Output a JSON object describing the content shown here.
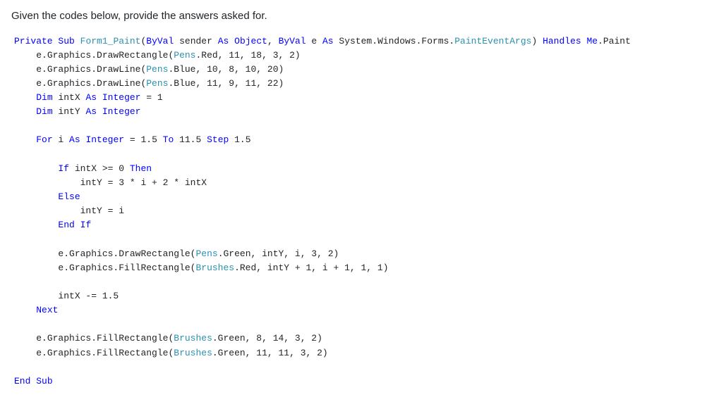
{
  "question": "Given the codes below, provide the answers asked for.",
  "code": {
    "l00a": "Private",
    "l00b": "Sub",
    "l00c": "Form1_Paint",
    "l00d": "(",
    "l00e": "ByVal",
    "l00f": " sender ",
    "l00g": "As",
    "l00h": "Object",
    "l00i": ", ",
    "l00j": "ByVal",
    "l00k": " e ",
    "l00l": "As",
    "l00m": " System.Windows.Forms.",
    "l00n": "PaintEventArgs",
    "l00o": ") ",
    "l00p": "Handles",
    "l00q": "Me",
    "l00r": ".Paint",
    "l01a": "e.Graphics.DrawRectangle(",
    "l01b": "Pens",
    "l01c": ".Red, 11, 18, 3, 2)",
    "l02a": "e.Graphics.DrawLine(",
    "l02b": "Pens",
    "l02c": ".Blue, 10, 8, 10, 20)",
    "l03a": "e.Graphics.DrawLine(",
    "l03b": "Pens",
    "l03c": ".Blue, 11, 9, 11, 22)",
    "l04a": "Dim",
    "l04b": " intX ",
    "l04c": "As",
    "l04d": "Integer",
    "l04e": " = 1",
    "l05a": "Dim",
    "l05b": " intY ",
    "l05c": "As",
    "l05d": "Integer",
    "l06a": "For",
    "l06b": " i ",
    "l06c": "As",
    "l06d": "Integer",
    "l06e": " = 1.5 ",
    "l06f": "To",
    "l06g": " 11.5 ",
    "l06h": "Step",
    "l06i": " 1.5",
    "l07a": "If",
    "l07b": " intX >= 0 ",
    "l07c": "Then",
    "l08a": "intY = 3 * i + 2 * intX",
    "l09a": "Else",
    "l10a": "intY = i",
    "l11a": "End",
    "l11b": "If",
    "l12a": "e.Graphics.DrawRectangle(",
    "l12b": "Pens",
    "l12c": ".Green, intY, i, 3, 2)",
    "l13a": "e.Graphics.FillRectangle(",
    "l13b": "Brushes",
    "l13c": ".Red, intY + 1, i + 1, 1, 1)",
    "l14a": "intX -= 1.5",
    "l15a": "Next",
    "l16a": "e.Graphics.FillRectangle(",
    "l16b": "Brushes",
    "l16c": ".Green, 8, 14, 3, 2)",
    "l17a": "e.Graphics.FillRectangle(",
    "l17b": "Brushes",
    "l17c": ".Green, 11, 11, 3, 2)",
    "l18a": "End",
    "l18b": "Sub"
  }
}
